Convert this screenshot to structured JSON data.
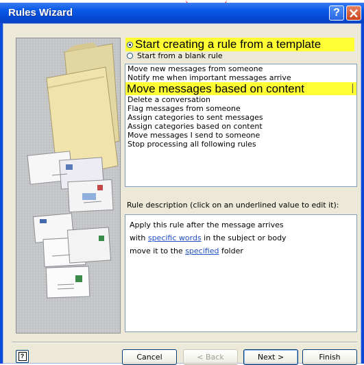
{
  "window": {
    "title": "Rules Wizard",
    "help_glyph": "?",
    "close_glyph": "×"
  },
  "template_choice": {
    "template_label": "Start creating a rule from a template",
    "blank_label": "Start from a blank rule",
    "selected": "template"
  },
  "rule_templates": {
    "items": [
      "Move new messages from someone",
      "Notify me when important messages arrive",
      "Move messages based on content",
      "Delete a conversation",
      "Flag messages from someone",
      "Assign categories to sent messages",
      "Assign categories based on content",
      "Move messages I send to someone",
      "Stop processing all following rules"
    ],
    "selected_index": 2
  },
  "rule_description": {
    "label": "Rule description (click on an underlined value to edit it):",
    "line1": "Apply this rule after the message arrives",
    "line2_prefix": "with ",
    "line2_link": "specific words",
    "line2_suffix": " in the subject or body",
    "line3_prefix": "move it to the ",
    "line3_link": "specified",
    "line3_suffix": " folder"
  },
  "footer": {
    "help_icon": "help-icon",
    "help_glyph": "?",
    "cancel_label": "Cancel",
    "back_label": "< Back",
    "next_label": "Next >",
    "finish_label": "Finish"
  },
  "colors": {
    "titlebar": "#0548d3",
    "highlight": "#ffff33",
    "link": "#1e4fc4",
    "dialog_bg": "#ece9d8"
  }
}
